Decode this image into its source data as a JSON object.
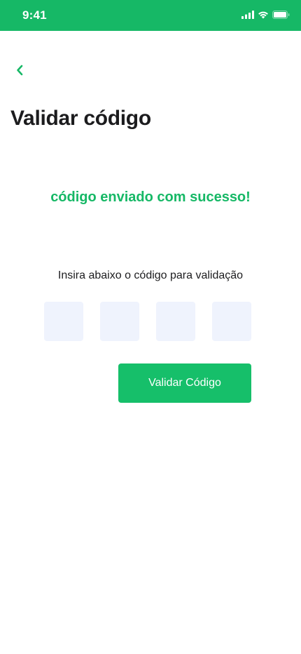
{
  "status_bar": {
    "time": "9:41",
    "icons": [
      "cellular-signal-icon",
      "wifi-icon",
      "battery-icon"
    ]
  },
  "header": {
    "back_icon": "chevron-left-icon",
    "title": "Validar código"
  },
  "main": {
    "success_message": "código enviado com sucesso!",
    "instruction": "Insira abaixo o código para validação",
    "code_inputs": [
      "",
      "",
      "",
      ""
    ],
    "submit_label": "Validar Código"
  },
  "colors": {
    "brand_green": "#16b866",
    "input_background": "#eff3fd",
    "title_text": "#1c1c1e"
  }
}
